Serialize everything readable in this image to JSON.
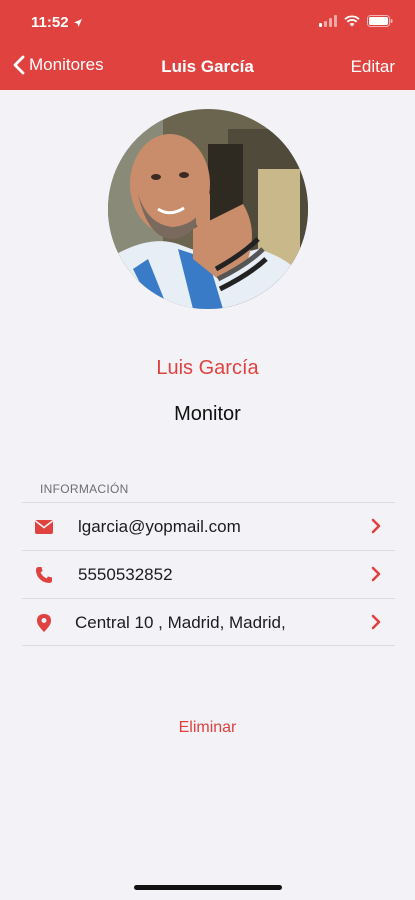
{
  "status_bar": {
    "time": "11:52"
  },
  "nav": {
    "back_label": "Monitores",
    "title": "Luis García",
    "edit_label": "Editar"
  },
  "profile": {
    "name": "Luis García",
    "role": "Monitor"
  },
  "info": {
    "section_title": "INFORMACIÓN",
    "rows": [
      {
        "icon": "envelope-icon",
        "value": "lgarcia@yopmail.com"
      },
      {
        "icon": "phone-icon",
        "value": "5550532852"
      },
      {
        "icon": "location-pin-icon",
        "value": "Central 10 , Madrid, Madrid,"
      }
    ]
  },
  "actions": {
    "delete_label": "Eliminar"
  },
  "colors": {
    "accent": "#e0423f",
    "background": "#f2f2f7"
  }
}
